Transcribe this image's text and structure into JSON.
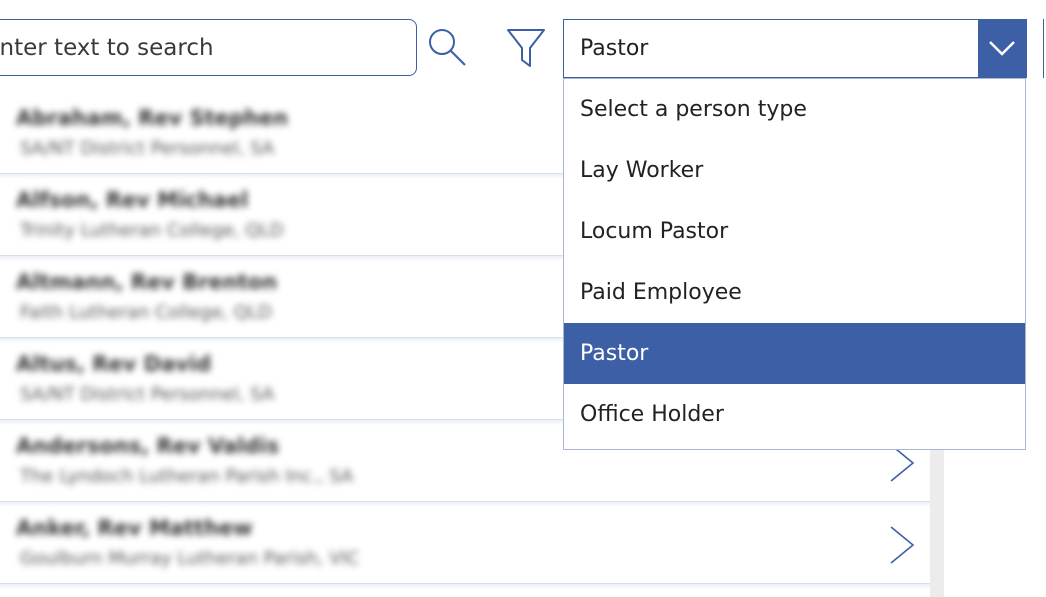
{
  "search": {
    "placeholder": "Enter text to search"
  },
  "icons": {
    "search": "search-icon",
    "filter": "filter-icon",
    "dropdown_chevron": "chevron-down-icon",
    "row_chevron": "chevron-right-icon"
  },
  "person_type_dropdown": {
    "selected_value": "Pastor",
    "options": [
      "Select a person type",
      "Lay Worker",
      "Locum Pastor",
      "Paid Employee",
      "Pastor",
      "Office Holder"
    ],
    "selected_index": 4
  },
  "people": [
    {
      "name": "Abraham, Rev Stephen",
      "org": "SA/NT District Personnel, SA"
    },
    {
      "name": "Alfson, Rev Michael",
      "org": "Trinity Lutheran College, QLD"
    },
    {
      "name": "Altmann, Rev Brenton",
      "org": "Faith Lutheran College, QLD"
    },
    {
      "name": "Altus, Rev David",
      "org": "SA/NT District Personnel, SA"
    },
    {
      "name": "Andersons, Rev Valdis",
      "org": "The Lyndoch Lutheran Parish Inc., SA"
    },
    {
      "name": "Anker, Rev Matthew",
      "org": "Goulburn Murray Lutheran Parish, VIC"
    }
  ],
  "colors": {
    "accent": "#3c5fa6",
    "selected_text": "#ffffff",
    "scrollbar_track": "#ececec"
  }
}
